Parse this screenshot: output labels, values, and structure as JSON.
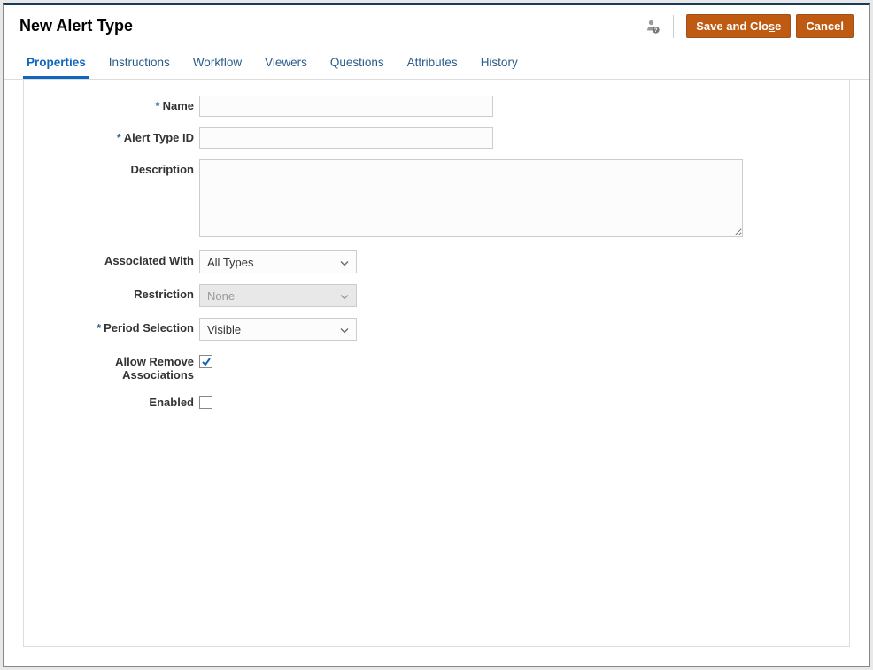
{
  "header": {
    "title": "New Alert Type",
    "save_label_pre": "Save and Clo",
    "save_label_key": "s",
    "save_label_post": "e",
    "cancel_label": "Cancel"
  },
  "tabs": [
    {
      "label": "Properties",
      "active": true
    },
    {
      "label": "Instructions",
      "active": false
    },
    {
      "label": "Workflow",
      "active": false
    },
    {
      "label": "Viewers",
      "active": false
    },
    {
      "label": "Questions",
      "active": false
    },
    {
      "label": "Attributes",
      "active": false
    },
    {
      "label": "History",
      "active": false
    }
  ],
  "form": {
    "name_label": "Name",
    "name_value": "",
    "alert_type_id_label": "Alert Type ID",
    "alert_type_id_value": "",
    "description_label": "Description",
    "description_value": "",
    "associated_with_label": "Associated With",
    "associated_with_value": "All Types",
    "restriction_label": "Restriction",
    "restriction_value": "None",
    "period_selection_label": "Period Selection",
    "period_selection_value": "Visible",
    "allow_remove_label": "Allow Remove Associations",
    "allow_remove_checked": true,
    "enabled_label": "Enabled",
    "enabled_checked": false
  }
}
